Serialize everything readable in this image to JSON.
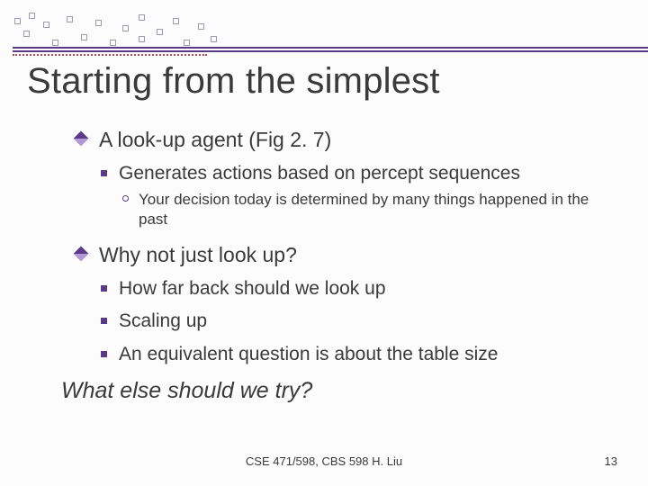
{
  "title": "Starting from the simplest",
  "bullets": {
    "l1_0": "A look-up agent (Fig 2. 7)",
    "l2_0": "Generates actions based on percept sequences",
    "l3_0": "Your decision today is determined by many things happened in the past",
    "l1_1": "Why not just look up?",
    "l2_1": "How far back should we look up",
    "l2_2": "Scaling up",
    "l2_3": "An equivalent question is about the table size"
  },
  "closing": "What else should we try?",
  "footer": {
    "center": "CSE 471/598, CBS 598 H. Liu",
    "page": "13"
  }
}
